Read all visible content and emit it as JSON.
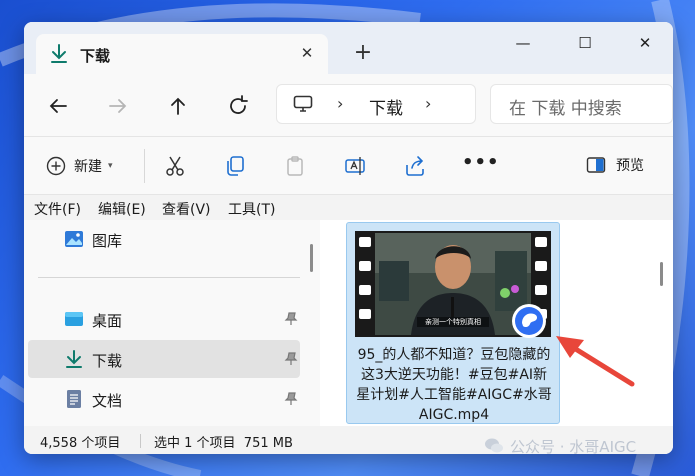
{
  "colors": {
    "accent": "#0f7b6c",
    "selection": "#cce4f7",
    "arrow": "#e8463a"
  },
  "tab": {
    "title": "下载",
    "icon": "download-icon"
  },
  "address": {
    "location": "下载"
  },
  "search": {
    "placeholder": "在 下载 中搜索"
  },
  "commands": {
    "new_label": "新建",
    "preview_label": "预览"
  },
  "menu": [
    "文件(F)",
    "编辑(E)",
    "查看(V)",
    "工具(T)"
  ],
  "nav": {
    "items": [
      {
        "label": "图库",
        "icon": "gallery-icon",
        "pinned": false
      },
      {
        "label": "桌面",
        "icon": "desktop-icon",
        "pinned": true
      },
      {
        "label": "下载",
        "icon": "download-icon",
        "pinned": true
      },
      {
        "label": "文档",
        "icon": "document-icon",
        "pinned": true
      }
    ]
  },
  "file": {
    "name": "95_的人都不知道？豆包隐藏的这3大逆天功能！#豆包#AI新星计划#人工智能#AIGC#水哥AIGC.mp4",
    "subtitle": "亲测一个特别真相"
  },
  "status": {
    "count": "4,558 个项目",
    "selection": "选中 1 个项目  751 MB"
  },
  "watermark": {
    "text": "公众号 · 水哥AIGC"
  }
}
